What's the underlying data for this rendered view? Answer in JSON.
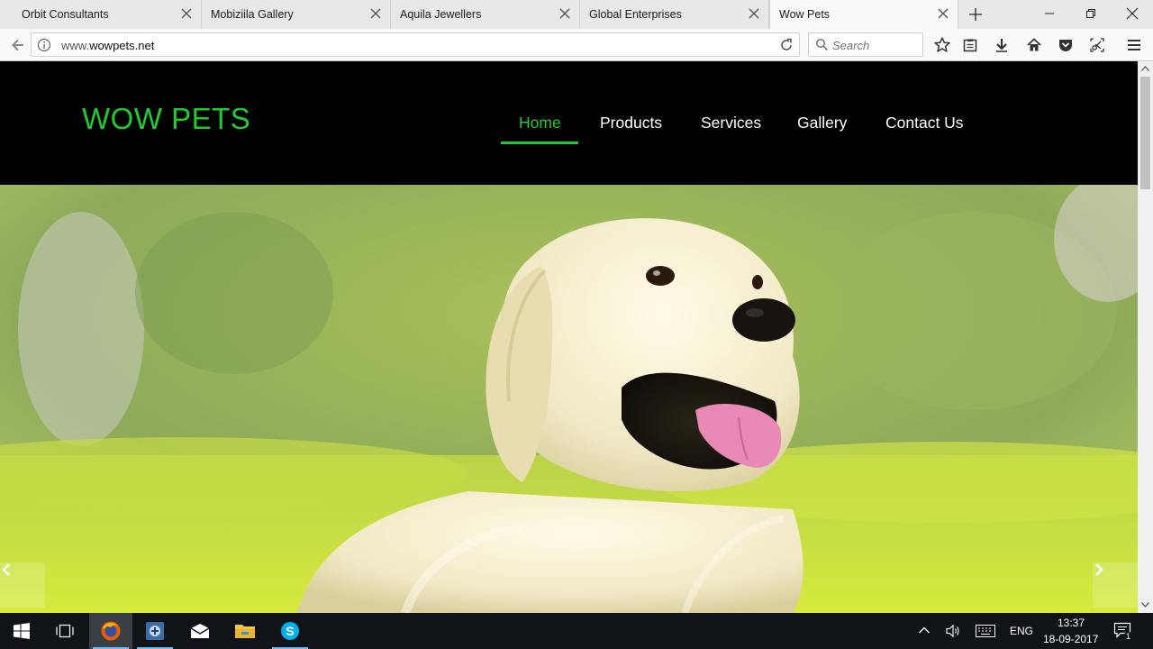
{
  "browser": {
    "tabs": [
      {
        "label": "Orbit Consultants"
      },
      {
        "label": "Mobiziila Gallery"
      },
      {
        "label": "Aquila Jewellers"
      },
      {
        "label": "Global Enterprises"
      },
      {
        "label": "Wow Pets"
      }
    ],
    "url_prefix": "www.",
    "url_domain": "wowpets.net",
    "search_placeholder": "Search"
  },
  "site": {
    "logo": "WOW PETS",
    "menu": [
      "Home",
      "Products",
      "Services",
      "Gallery",
      "Contact Us"
    ],
    "active_menu": "Home",
    "accent_color": "#1fcc2f"
  },
  "taskbar": {
    "language": "ENG",
    "time": "13:37",
    "date": "18-09-2017",
    "notification_count": "1"
  }
}
